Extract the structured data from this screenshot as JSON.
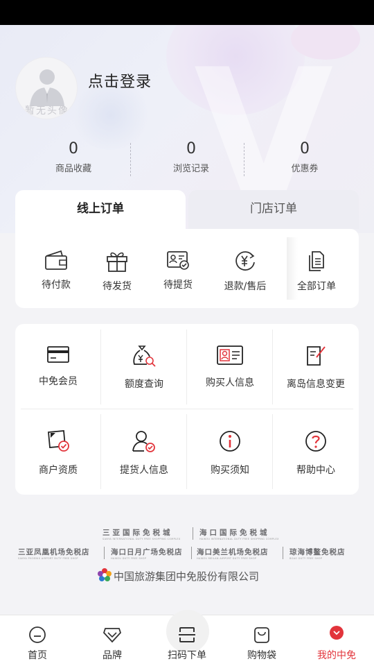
{
  "profile": {
    "avatar_text": "暂无头像",
    "login_label": "点击登录"
  },
  "stats": [
    {
      "value": "0",
      "label": "商品收藏"
    },
    {
      "value": "0",
      "label": "浏览记录"
    },
    {
      "value": "0",
      "label": "优惠券"
    }
  ],
  "tabs": {
    "online": "线上订单",
    "store": "门店订单"
  },
  "orders": [
    {
      "label": "待付款",
      "icon": "wallet-icon"
    },
    {
      "label": "待发货",
      "icon": "gift-icon"
    },
    {
      "label": "待提货",
      "icon": "pickup-card-icon"
    },
    {
      "label": "退款/售后",
      "icon": "refund-icon"
    },
    {
      "label": "全部订单",
      "icon": "documents-icon"
    }
  ],
  "services": [
    {
      "label": "中免会员",
      "icon": "member-card-icon"
    },
    {
      "label": "额度查询",
      "icon": "money-bag-search-icon"
    },
    {
      "label": "购买人信息",
      "icon": "id-card-icon"
    },
    {
      "label": "离岛信息变更",
      "icon": "edit-doc-icon"
    },
    {
      "label": "商户资质",
      "icon": "certificate-icon"
    },
    {
      "label": "提货人信息",
      "icon": "person-check-icon"
    },
    {
      "label": "购买须知",
      "icon": "info-icon"
    },
    {
      "label": "帮助中心",
      "icon": "question-icon"
    }
  ],
  "partners": {
    "row1": [
      {
        "name": "三亚国际免税城",
        "sub": "SANYA INTERNATIONAL DUTY FREE SHOPPING COMPLEX"
      },
      {
        "name": "海口国际免税城",
        "sub": "HAIKOU INTERNATIONAL DUTY FREE SHOPPING COMPLEX"
      }
    ],
    "row2": [
      {
        "name": "三亚凤凰机场免税店",
        "sub": "SANYA PHOENIX AIRPORT DUTY FREE SHOP"
      },
      {
        "name": "海口日月广场免税店",
        "sub": "HAIKOU DUTY FREE SHOP"
      },
      {
        "name": "海口美兰机场免税店",
        "sub": "HAIKOU MEILAN AIRPORT DUTY FREE SHOP"
      },
      {
        "name": "琼海博鳌免税店",
        "sub": "BOAO DUTY FREE SHOP"
      }
    ],
    "company": "中国旅游集团中免股份有限公司"
  },
  "nav": [
    {
      "label": "首页",
      "icon": "home-icon"
    },
    {
      "label": "品牌",
      "icon": "brand-icon"
    },
    {
      "label": "扫码下单",
      "icon": "scan-icon"
    },
    {
      "label": "购物袋",
      "icon": "bag-icon"
    },
    {
      "label": "我的中免",
      "icon": "profile-icon"
    }
  ],
  "colors": {
    "accent": "#e2343b",
    "background": "#f3f3f6"
  }
}
